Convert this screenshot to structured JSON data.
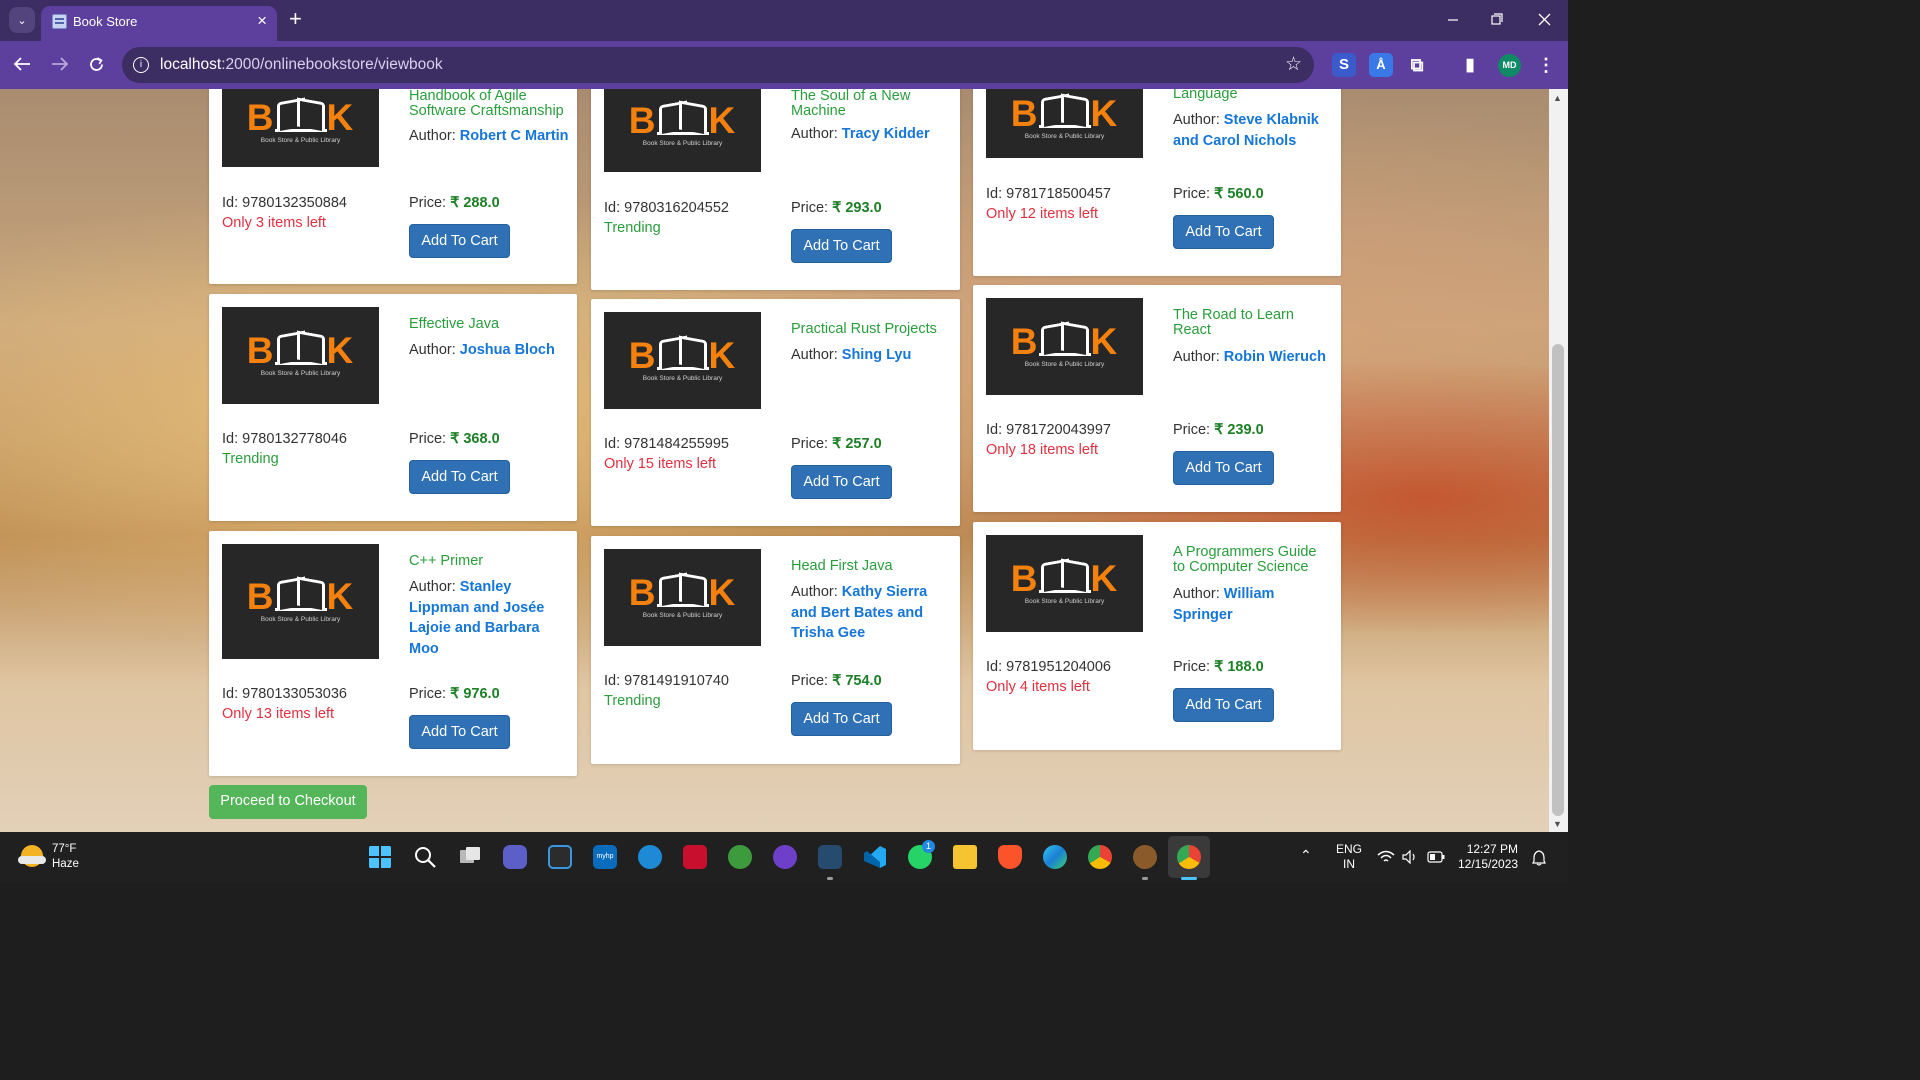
{
  "browser": {
    "tab_title": "Book Store",
    "tab_close": "×",
    "new_tab": "+",
    "tab_list": "⌄",
    "url_host": "localhost",
    "url_path": ":2000/onlinebookstore/viewbook",
    "profile_initials": "MD"
  },
  "labels": {
    "id_prefix": "Id: ",
    "author_prefix": "Author: ",
    "price_prefix": "Price: ",
    "currency": "₹",
    "add_to_cart": "Add To Cart",
    "checkout": "Proceed to Checkout",
    "cover_tagline": "Book Store & Public Library"
  },
  "books": [
    {
      "title": "Handbook of Agile Software Craftsmanship",
      "author": "Robert C Martin",
      "id": "9780132350884",
      "status": "Only 3 items left",
      "status_kind": "stock",
      "price": "288.0"
    },
    {
      "title": "The Soul of a New Machine",
      "author": "Tracy Kidder",
      "id": "9780316204552",
      "status": "Trending",
      "status_kind": "trending",
      "price": "293.0"
    },
    {
      "title": "Language",
      "author": "Steve Klabnik and Carol Nichols",
      "id": "9781718500457",
      "status": "Only 12 items left",
      "status_kind": "stock",
      "price": "560.0"
    },
    {
      "title": "Effective Java",
      "author": "Joshua Bloch",
      "id": "9780132778046",
      "status": "Trending",
      "status_kind": "trending",
      "price": "368.0"
    },
    {
      "title": "Practical Rust Projects",
      "author": "Shing Lyu",
      "id": "9781484255995",
      "status": "Only 15 items left",
      "status_kind": "stock",
      "price": "257.0"
    },
    {
      "title": "The Road to Learn React",
      "author": "Robin Wieruch",
      "id": "9781720043997",
      "status": "Only 18 items left",
      "status_kind": "stock",
      "price": "239.0"
    },
    {
      "title": "C++ Primer",
      "author": "Stanley Lippman and Josée Lajoie and Barbara Moo",
      "id": "9780133053036",
      "status": "Only 13 items left",
      "status_kind": "stock",
      "price": "976.0"
    },
    {
      "title": "Head First Java",
      "author": "Kathy Sierra and Bert Bates and Trisha Gee",
      "id": "9781491910740",
      "status": "Trending",
      "status_kind": "trending",
      "price": "754.0"
    },
    {
      "title": "A Programmers Guide to Computer Science",
      "author": "William Springer",
      "id": "9781951204006",
      "status": "Only 4 items left",
      "status_kind": "stock",
      "price": "188.0"
    }
  ],
  "taskbar": {
    "weather_temp": "77°F",
    "weather_desc": "Haze",
    "lang_1": "ENG",
    "lang_2": "IN",
    "time": "12:27 PM",
    "date": "12/15/2023",
    "whatsapp_badge": "1"
  },
  "colors": {
    "browser_frame": "#3c2d63",
    "toolbar": "#5d3f9e",
    "button_primary": "#2f71b4",
    "button_success": "#55b659",
    "title_green": "#2a9d3c",
    "author_blue": "#1576d8",
    "stock_red": "#e0303f",
    "price_green": "#1c7f25"
  }
}
